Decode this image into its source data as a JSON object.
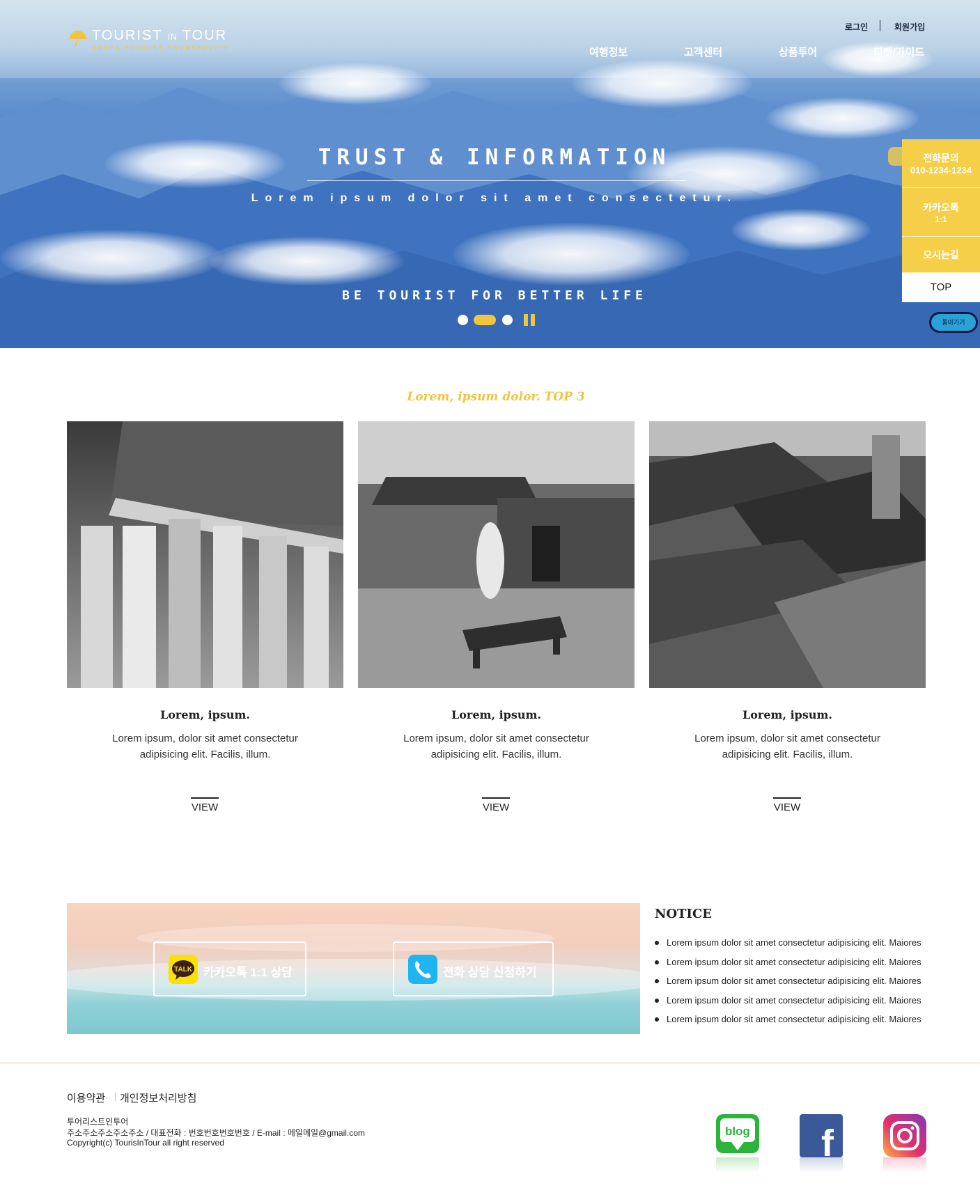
{
  "brand": {
    "name_main": "TOURIST",
    "name_in": "IN",
    "name_tail": "TOUR",
    "tagline": "KOREA TOURIST TOURSERVICE"
  },
  "utility": {
    "login": "로그인",
    "join": "회원가입"
  },
  "nav": [
    "여행정보",
    "고객센터",
    "상품투어",
    "티켓/가이드"
  ],
  "hero": {
    "title": "TRUST & INFORMATION",
    "subtitle": "Lorem ipsum dolor sit amet consectetur.",
    "slogan": "BE TOURIST FOR BETTER LIFE",
    "active_slide": 2,
    "slide_count": 3
  },
  "quick_menu": {
    "phone_label": "전화문의",
    "phone_number": "010-1234-1234",
    "kakao_label": "카카오톡",
    "kakao_sub": "1:1",
    "directions": "오시는길",
    "top": "TOP",
    "back": "돌아가기"
  },
  "top3": {
    "title": "Lorem, ipsum dolor. TOP 3",
    "cards": [
      {
        "title": "Lorem, ipsum.",
        "desc": "Lorem ipsum, dolor sit amet consectetur adipisicing elit. Facilis, illum.",
        "view": "VIEW"
      },
      {
        "title": "Lorem, ipsum.",
        "desc": "Lorem ipsum, dolor sit amet consectetur adipisicing elit. Facilis, illum.",
        "view": "VIEW"
      },
      {
        "title": "Lorem, ipsum.",
        "desc": "Lorem ipsum, dolor sit amet consectetur adipisicing elit. Facilis, illum.",
        "view": "VIEW"
      }
    ]
  },
  "consult": {
    "kakao_icon_text": "TALK",
    "kakao_label": "카카오톡 1:1 상담",
    "phone_label": "전화 상담 신청하기"
  },
  "notice": {
    "title": "NOTICE",
    "items": [
      "Lorem ipsum dolor sit amet consectetur adipisicing elit. Maiores",
      "Lorem ipsum dolor sit amet consectetur adipisicing elit. Maiores",
      "Lorem ipsum dolor sit amet consectetur adipisicing elit. Maiores",
      "Lorem ipsum dolor sit amet consectetur adipisicing elit. Maiores",
      "Lorem ipsum dolor sit amet consectetur adipisicing elit. Maiores"
    ]
  },
  "footer": {
    "terms": "이용약관",
    "privacy": "개인정보처리방침",
    "company": "투어리스트인투어",
    "address": "주소주소주소주소주소 / 대표전화 : 번호번호번호번호 / E-mail : 메일메일@gmail.com",
    "copyright": "Copyright(c) TourisInTour all right reserved",
    "blog_text": "blog",
    "facebook_text": "f"
  },
  "colors": {
    "accent": "#f2c53d",
    "quick_bg": "#f4cf47",
    "kakao": "#fae100",
    "phone_icon": "#1fb5f0",
    "blog": "#2ab43a",
    "facebook": "#3b5998"
  },
  "icons": [
    "logo-mark-icon",
    "pause-icon",
    "kakao-talk-icon",
    "phone-icon",
    "blog-icon",
    "facebook-icon",
    "instagram-icon"
  ]
}
